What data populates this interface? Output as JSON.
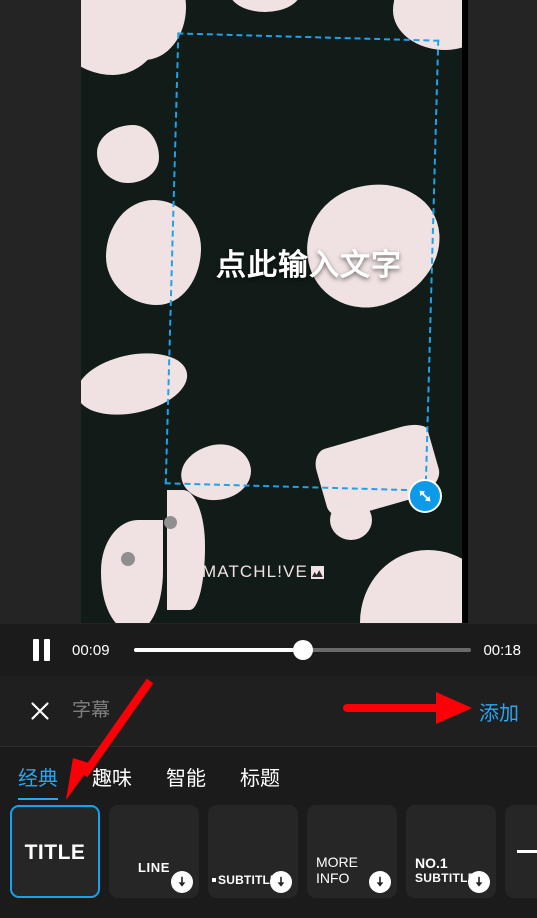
{
  "preview": {
    "text_element": {
      "value": "点此输入文字"
    },
    "watermark": {
      "text": "MATCHL!VE",
      "mark": "mountain-logo"
    },
    "handle": {
      "icon": "resize-diagonal-icon"
    }
  },
  "playback": {
    "pause_icon": "pause-icon",
    "current_time": "00:09",
    "total_time": "00:18",
    "progress_percent": 50
  },
  "subtitle_bar": {
    "close_icon": "close-icon",
    "input_value": "",
    "input_placeholder": "字幕",
    "add_label": "添加"
  },
  "tabs": [
    {
      "label": "经典",
      "active": true
    },
    {
      "label": "趣味",
      "active": false
    },
    {
      "label": "智能",
      "active": false
    },
    {
      "label": "标题",
      "active": false
    }
  ],
  "cards": [
    {
      "label": "TITLE",
      "selected": true,
      "downloadable": false
    },
    {
      "label": "LINE",
      "selected": false,
      "downloadable": true
    },
    {
      "label": "SUBTITLE",
      "selected": false,
      "downloadable": true
    },
    {
      "label_line1": "MORE",
      "label_line2": "INFO",
      "selected": false,
      "downloadable": true
    },
    {
      "label_line1": "NO.1",
      "label_line2": "SUBTITLE",
      "selected": false,
      "downloadable": true
    },
    {
      "label": "",
      "selected": false,
      "downloadable": false
    }
  ],
  "colors": {
    "accent_blue": "#2aa6ef",
    "selection_blue": "#14a3f0",
    "annotation_red": "#fb0007",
    "canvas_bg": "#111b17",
    "blob_pink": "#f0e2e2",
    "panel_bg": "#1b1b1b"
  }
}
